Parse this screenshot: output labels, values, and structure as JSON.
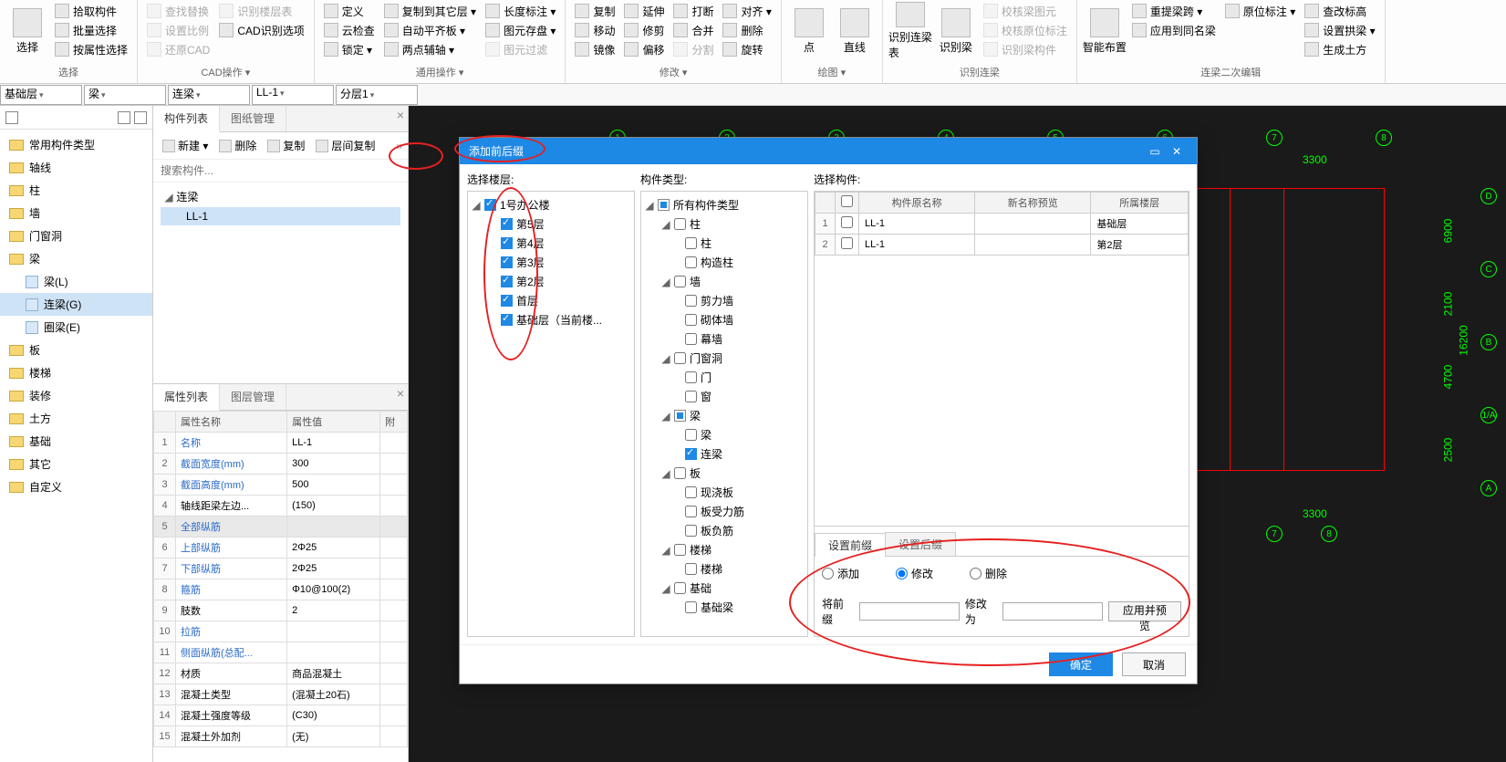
{
  "ribbon": {
    "group_select": {
      "label": "选择",
      "big": "选择",
      "items": [
        "拾取构件",
        "批量选择",
        "按属性选择"
      ]
    },
    "group_cad": {
      "label": "CAD操作 ▾",
      "items": [
        "查找替换",
        "设置比例",
        "还原CAD",
        "识别楼层表",
        "CAD识别选项"
      ]
    },
    "group_general": {
      "label": "通用操作 ▾",
      "col1": [
        "定义",
        "云检查",
        "锁定 ▾"
      ],
      "col2": [
        "复制到其它层 ▾",
        "自动平齐板 ▾",
        "两点辅轴 ▾"
      ],
      "col3": [
        "长度标注 ▾",
        "图元存盘 ▾",
        "图元过滤"
      ]
    },
    "group_modify": {
      "label": "修改 ▾",
      "col1": [
        "复制",
        "移动",
        "镜像"
      ],
      "col2": [
        "延伸",
        "修剪",
        "偏移"
      ],
      "col3": [
        "打断",
        "合并",
        "分割"
      ],
      "col4": [
        "对齐 ▾",
        "删除",
        "旋转"
      ]
    },
    "group_draw": {
      "label": "绘图 ▾",
      "items": [
        "点",
        "直线"
      ]
    },
    "group_recognize": {
      "label": "识别连梁",
      "items": [
        "识别连梁表",
        "识别梁"
      ],
      "right": [
        "校核梁图元",
        "校核原位标注",
        "识别梁构件"
      ]
    },
    "group_secondary": {
      "label": "连梁二次编辑",
      "big": "智能布置",
      "items": [
        "重提梁跨 ▾",
        "应用到同名梁"
      ],
      "right": [
        "原位标注 ▾",
        "查改标高",
        "设置拱梁 ▾",
        "生成土方"
      ]
    }
  },
  "filters": {
    "f1": "基础层",
    "f2": "梁",
    "f3": "连梁",
    "f4": "LL-1",
    "f5": "分层1"
  },
  "nav": {
    "items": [
      "常用构件类型",
      "轴线",
      "柱",
      "墙",
      "门窗洞",
      "梁",
      "板",
      "楼梯",
      "装修",
      "土方",
      "基础",
      "其它",
      "自定义"
    ],
    "beam_children": [
      {
        "label": "梁(L)"
      },
      {
        "label": "连梁(G)",
        "selected": true
      },
      {
        "label": "圈梁(E)"
      }
    ]
  },
  "component": {
    "tabs": [
      "构件列表",
      "图纸管理"
    ],
    "toolbar": [
      "新建 ▾",
      "删除",
      "复制",
      "层间复制"
    ],
    "search_placeholder": "搜索构件...",
    "tree_root": "连梁",
    "tree_item": "LL-1"
  },
  "properties": {
    "tabs": [
      "属性列表",
      "图层管理"
    ],
    "headers": [
      "属性名称",
      "属性值",
      "附"
    ],
    "rows": [
      {
        "n": 1,
        "name": "名称",
        "val": "LL-1",
        "link": true
      },
      {
        "n": 2,
        "name": "截面宽度(mm)",
        "val": "300",
        "link": true
      },
      {
        "n": 3,
        "name": "截面高度(mm)",
        "val": "500",
        "link": true
      },
      {
        "n": 4,
        "name": "轴线距梁左边...",
        "val": "(150)"
      },
      {
        "n": 5,
        "name": "全部纵筋",
        "val": "",
        "link": true,
        "hl": true
      },
      {
        "n": 6,
        "name": "上部纵筋",
        "val": "2Φ25",
        "link": true
      },
      {
        "n": 7,
        "name": "下部纵筋",
        "val": "2Φ25",
        "link": true
      },
      {
        "n": 8,
        "name": "箍筋",
        "val": "Φ10@100(2)",
        "link": true
      },
      {
        "n": 9,
        "name": "肢数",
        "val": "2"
      },
      {
        "n": 10,
        "name": "拉筋",
        "val": "",
        "link": true
      },
      {
        "n": 11,
        "name": "侧面纵筋(总配...",
        "val": "",
        "link": true
      },
      {
        "n": 12,
        "name": "材质",
        "val": "商品混凝土"
      },
      {
        "n": 13,
        "name": "混凝土类型",
        "val": "(混凝土20石)"
      },
      {
        "n": 14,
        "name": "混凝土强度等级",
        "val": "(C30)"
      },
      {
        "n": 15,
        "name": "混凝土外加剂",
        "val": "(无)"
      }
    ]
  },
  "dialog": {
    "title": "添加前后缀",
    "col_labels": [
      "选择楼层:",
      "构件类型:",
      "选择构件:"
    ],
    "floors": {
      "root": "1号办公楼",
      "items": [
        "第5层",
        "第4层",
        "第3层",
        "第2层",
        "首层",
        "基础层（当前楼..."
      ]
    },
    "types": {
      "root": "所有构件类型",
      "groups": [
        {
          "label": "柱",
          "children": [
            "柱",
            "构造柱"
          ]
        },
        {
          "label": "墙",
          "children": [
            "剪力墙",
            "砌体墙",
            "幕墙"
          ]
        },
        {
          "label": "门窗洞",
          "children": [
            "门",
            "窗"
          ]
        },
        {
          "label": "梁",
          "children": [
            "梁",
            "连梁"
          ],
          "checked_child": "连梁",
          "half": true
        },
        {
          "label": "板",
          "children": [
            "现浇板",
            "板受力筋",
            "板负筋"
          ]
        },
        {
          "label": "楼梯",
          "children": [
            "楼梯"
          ]
        },
        {
          "label": "基础",
          "children": [
            "基础梁"
          ]
        }
      ]
    },
    "grid": {
      "headers": [
        "构件原名称",
        "新名称预览",
        "所属楼层"
      ],
      "rows": [
        {
          "n": 1,
          "name": "LL-1",
          "preview": "",
          "floor": "基础层"
        },
        {
          "n": 2,
          "name": "LL-1",
          "preview": "",
          "floor": "第2层"
        }
      ]
    },
    "settings": {
      "tabs": [
        "设置前缀",
        "设置后缀"
      ],
      "radios": [
        "添加",
        "修改",
        "删除"
      ],
      "selected_radio": "修改",
      "label_from": "将前缀",
      "label_to": "修改为",
      "apply_btn": "应用并预览"
    },
    "ok": "确定",
    "cancel": "取消"
  },
  "canvas": {
    "top_nodes": [
      "1",
      "2",
      "3",
      "4",
      "5",
      "6",
      "7",
      "8"
    ],
    "right_nodes": [
      "D",
      "C",
      "B",
      "1/A",
      "A"
    ],
    "bottom_nodes": [
      "7",
      "8"
    ],
    "dims_top": "3300",
    "dims_bottom": "3300",
    "dims_right": [
      "6900",
      "2100",
      "4700",
      "2500"
    ],
    "dim_far_right": "16200"
  }
}
